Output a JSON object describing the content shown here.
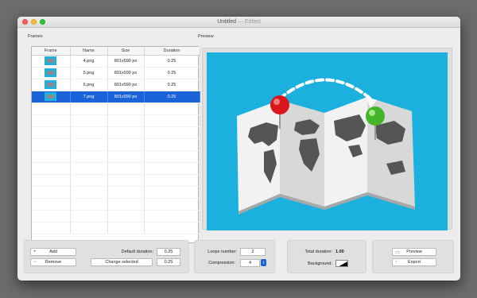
{
  "window": {
    "title": "Untitled",
    "title_suffix": "— Edited"
  },
  "frames": {
    "label": "Frames",
    "columns": [
      "Frame",
      "Name",
      "Size",
      "Duration"
    ],
    "rows": [
      {
        "name": "4.png",
        "size": "801x590 px",
        "duration": "0.25",
        "selected": false
      },
      {
        "name": "5.png",
        "size": "801x590 px",
        "duration": "0.25",
        "selected": false
      },
      {
        "name": "6.png",
        "size": "801x590 px",
        "duration": "0.25",
        "selected": false
      },
      {
        "name": "7.png",
        "size": "801x590 px",
        "duration": "0.25",
        "selected": true
      }
    ]
  },
  "preview": {
    "label": "Preview",
    "background_color": "#1cb0de"
  },
  "controls": {
    "add_label": "Add",
    "remove_label": "Remove",
    "default_duration_label": "Default duration:",
    "default_duration_value": "0.25",
    "change_selected_label": "Change selected",
    "change_selected_value": "0.25",
    "loops_label": "Loops number:",
    "loops_value": "2",
    "compression_label": "Compression:",
    "compression_value": "4",
    "total_duration_label": "Total duration:",
    "total_duration_value": "1.00",
    "background_label": "Background:",
    "preview_button_label": "Preview",
    "export_button_label": "Export"
  },
  "colors": {
    "selection": "#1b63d8",
    "pin_red": "#d8161b",
    "pin_green": "#44b52a"
  }
}
